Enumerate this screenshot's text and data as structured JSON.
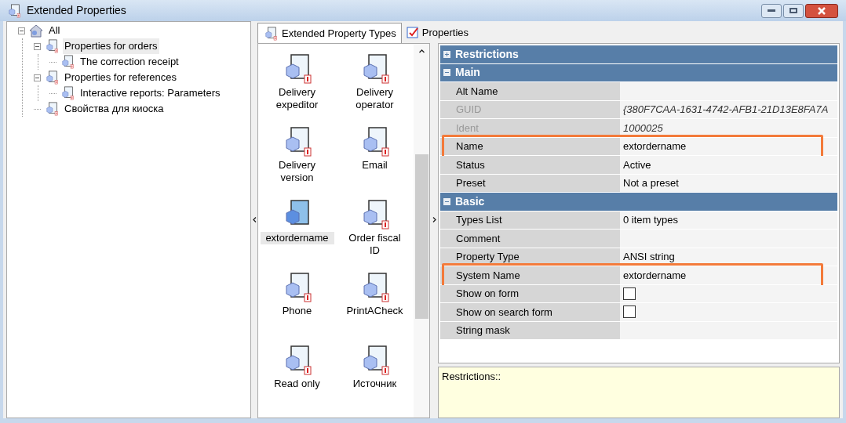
{
  "window": {
    "title": "Extended Properties"
  },
  "tree": [
    {
      "label": "All",
      "selected": false,
      "expanded": true,
      "children": [
        {
          "label": "Properties for orders",
          "selected": true,
          "expanded": true,
          "children": [
            {
              "label": "The correction receipt",
              "selected": false
            }
          ]
        },
        {
          "label": "Properties for references",
          "selected": false,
          "expanded": true,
          "children": [
            {
              "label": "Interactive reports: Parameters",
              "selected": false
            }
          ]
        },
        {
          "label": "Свойства для киоска",
          "selected": false
        }
      ]
    }
  ],
  "tabs": [
    {
      "label": "Extended Property Types",
      "kind": "types",
      "selected": true
    },
    {
      "label": "Properties",
      "kind": "properties",
      "selected": false
    }
  ],
  "types": [
    {
      "label": "Delivery expeditor",
      "selected": false
    },
    {
      "label": "Delivery operator",
      "selected": false
    },
    {
      "label": "Delivery version",
      "selected": false
    },
    {
      "label": "Email",
      "selected": false
    },
    {
      "label": "extordername",
      "selected": true
    },
    {
      "label": "Order fiscal ID",
      "selected": false
    },
    {
      "label": "Phone",
      "selected": false
    },
    {
      "label": "PrintACheck",
      "selected": false
    },
    {
      "label": "Read only",
      "selected": false
    },
    {
      "label": "Источник",
      "selected": false
    }
  ],
  "sections": [
    {
      "title": "Restrictions",
      "expanded": false
    },
    {
      "title": "Main",
      "expanded": true,
      "rows": [
        {
          "label": "Alt Name",
          "kind": "text",
          "disabled": false,
          "highlighted": false
        },
        {
          "label": "GUID",
          "kind": "text",
          "value": "{380F7CAA-1631-4742-AFB1-21D13E8FA7A",
          "disabled": true,
          "highlighted": false
        },
        {
          "label": "Ident",
          "kind": "text",
          "value": "1000025",
          "disabled": true,
          "highlighted": false
        },
        {
          "label": "Name",
          "kind": "text",
          "value": "extordername",
          "disabled": false,
          "highlighted": true
        },
        {
          "label": "Status",
          "kind": "text",
          "value": "Active",
          "disabled": false,
          "highlighted": false
        },
        {
          "label": "Preset",
          "kind": "text",
          "value": "Not a preset",
          "disabled": false,
          "highlighted": false
        }
      ]
    },
    {
      "title": "Basic",
      "expanded": true,
      "rows": [
        {
          "label": "Types List",
          "kind": "text",
          "value": "0 item types",
          "disabled": false,
          "highlighted": false
        },
        {
          "label": "Comment",
          "kind": "text",
          "disabled": false,
          "highlighted": false
        },
        {
          "label": "Property Type",
          "kind": "text",
          "value": "ANSI string",
          "disabled": false,
          "highlighted": false
        },
        {
          "label": "System Name",
          "kind": "text",
          "value": "extordername",
          "disabled": false,
          "highlighted": true
        },
        {
          "label": "Show on form",
          "kind": "checkbox",
          "checked": false,
          "disabled": false,
          "highlighted": false
        },
        {
          "label": "Show on search form",
          "kind": "checkbox",
          "checked": false,
          "disabled": false,
          "highlighted": false
        },
        {
          "label": "String mask",
          "kind": "text",
          "disabled": false,
          "highlighted": false
        }
      ]
    }
  ],
  "description": "Restrictions::"
}
